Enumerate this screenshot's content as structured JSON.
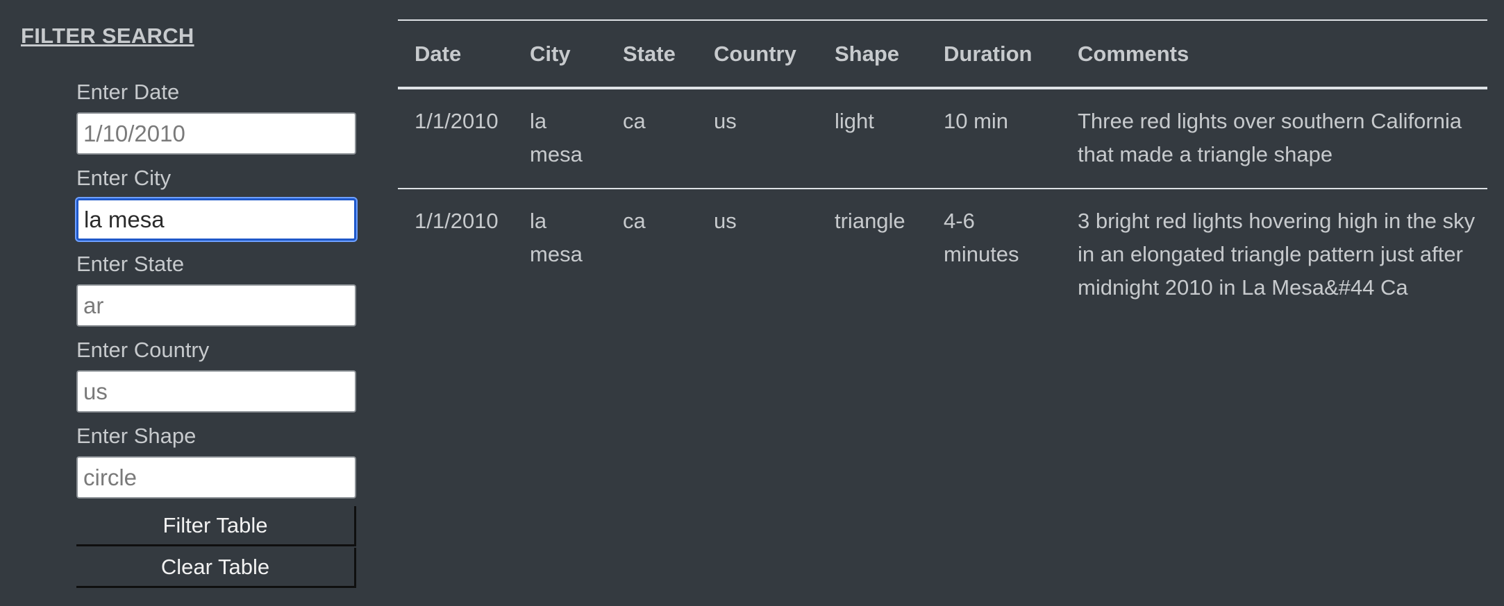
{
  "sidebar": {
    "title": "FILTER SEARCH",
    "filters": [
      {
        "label": "Enter Date",
        "placeholder": "1/10/2010",
        "value": ""
      },
      {
        "label": "Enter City",
        "placeholder": "",
        "value": "la mesa"
      },
      {
        "label": "Enter State",
        "placeholder": "ar",
        "value": ""
      },
      {
        "label": "Enter Country",
        "placeholder": "us",
        "value": ""
      },
      {
        "label": "Enter Shape",
        "placeholder": "circle",
        "value": ""
      }
    ],
    "filter_button": "Filter Table",
    "clear_button": "Clear Table"
  },
  "table": {
    "columns": [
      "Date",
      "City",
      "State",
      "Country",
      "Shape",
      "Duration",
      "Comments"
    ],
    "rows": [
      [
        "1/1/2010",
        "la mesa",
        "ca",
        "us",
        "light",
        "10 min",
        "Three red lights over southern California that made a triangle shape"
      ],
      [
        "1/1/2010",
        "la mesa",
        "ca",
        "us",
        "triangle",
        "4-6 minutes",
        "3 bright red lights hovering high in the sky in an elongated triangle pattern just after midnight 2010 in La Mesa&#44 Ca"
      ]
    ]
  },
  "colors": {
    "background": "#343a40",
    "text": "#c7cacd",
    "focus_ring": "#1f58c9",
    "table_border": "#dee2e6"
  }
}
